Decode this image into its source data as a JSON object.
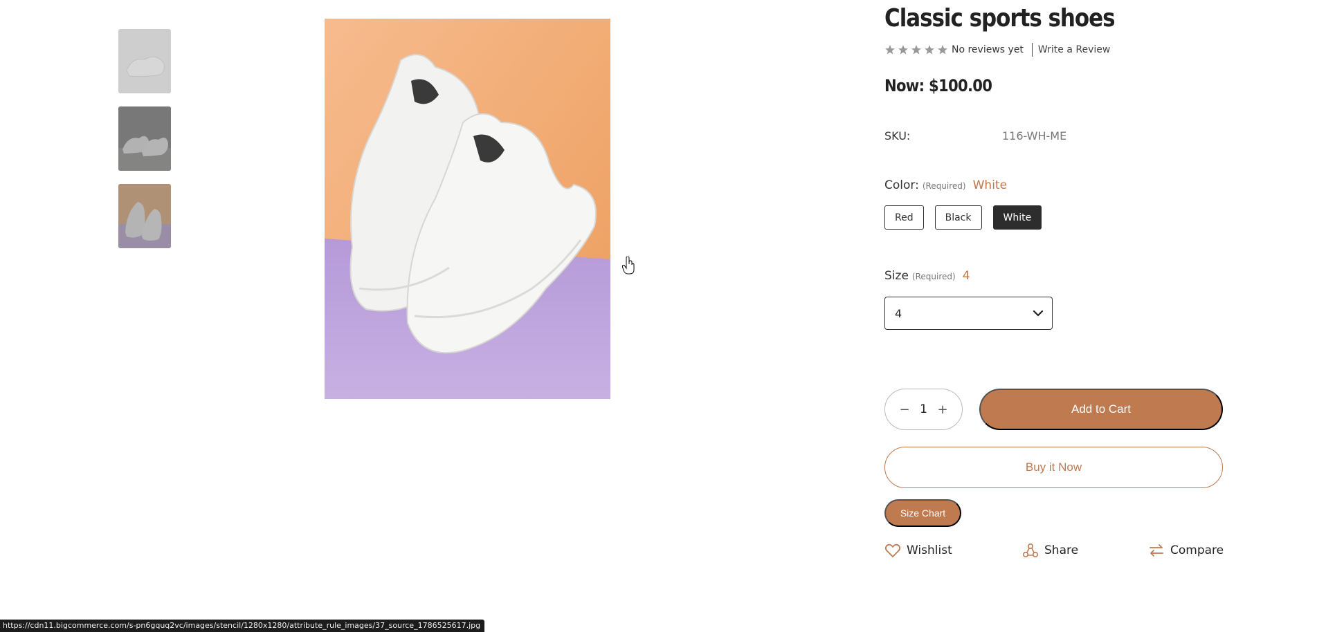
{
  "gallery": {
    "thumbnails": [
      {
        "name": "thumbnail-shoe-white-1",
        "state": "active"
      },
      {
        "name": "thumbnail-shoe-white-2",
        "state": "inactive"
      },
      {
        "name": "thumbnail-shoe-white-3",
        "state": "inactive"
      }
    ],
    "main_image": "white-sneakers-on-orange-and-purple-background"
  },
  "product": {
    "title": "Classic sports shoes",
    "rating": {
      "stars": 5,
      "reviews_text": "No reviews yet",
      "write_review_label": "Write a Review"
    },
    "price": "Now: $100.00",
    "sku_label": "SKU:",
    "sku_value": "116-WH-ME",
    "color": {
      "label": "Color:",
      "required": "(Required)",
      "selected": "White",
      "options": [
        "Red",
        "Black",
        "White"
      ]
    },
    "size": {
      "label": "Size",
      "required": "(Required)",
      "selected": "4",
      "select_value": "4"
    },
    "quantity": {
      "minus": "−",
      "value": "1",
      "plus": "+"
    },
    "add_to_cart_label": "Add to Cart",
    "buy_now_label": "Buy it Now",
    "size_chart_label": "Size Chart",
    "actions": {
      "wishlist": "Wishlist",
      "share": "Share",
      "compare": "Compare"
    }
  },
  "status_bar": {
    "url": "https://cdn11.bigcommerce.com/s-pn6gquq2vc/images/stencil/1280x1280/attribute_rule_images/37_source_1786525617.jpg"
  },
  "colors": {
    "accent": "#bf7a50",
    "selected_swatch": "#2d2d2d",
    "star": "#999999"
  }
}
